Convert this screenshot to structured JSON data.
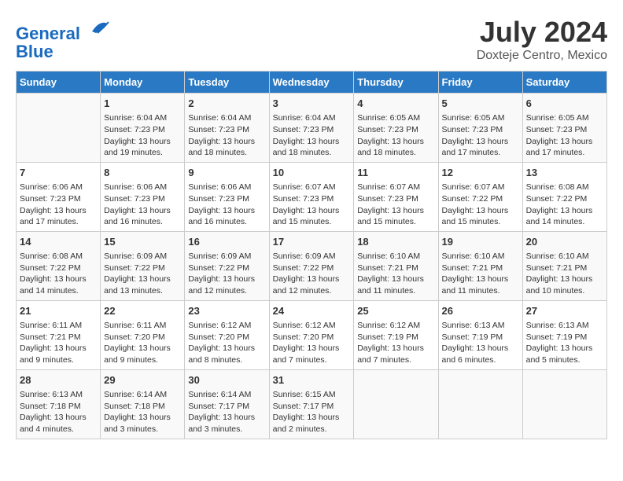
{
  "header": {
    "logo_line1": "General",
    "logo_line2": "Blue",
    "month": "July 2024",
    "location": "Doxteje Centro, Mexico"
  },
  "days_of_week": [
    "Sunday",
    "Monday",
    "Tuesday",
    "Wednesday",
    "Thursday",
    "Friday",
    "Saturday"
  ],
  "weeks": [
    [
      {
        "day": "",
        "sunrise": "",
        "sunset": "",
        "daylight": ""
      },
      {
        "day": "1",
        "sunrise": "Sunrise: 6:04 AM",
        "sunset": "Sunset: 7:23 PM",
        "daylight": "Daylight: 13 hours and 19 minutes."
      },
      {
        "day": "2",
        "sunrise": "Sunrise: 6:04 AM",
        "sunset": "Sunset: 7:23 PM",
        "daylight": "Daylight: 13 hours and 18 minutes."
      },
      {
        "day": "3",
        "sunrise": "Sunrise: 6:04 AM",
        "sunset": "Sunset: 7:23 PM",
        "daylight": "Daylight: 13 hours and 18 minutes."
      },
      {
        "day": "4",
        "sunrise": "Sunrise: 6:05 AM",
        "sunset": "Sunset: 7:23 PM",
        "daylight": "Daylight: 13 hours and 18 minutes."
      },
      {
        "day": "5",
        "sunrise": "Sunrise: 6:05 AM",
        "sunset": "Sunset: 7:23 PM",
        "daylight": "Daylight: 13 hours and 17 minutes."
      },
      {
        "day": "6",
        "sunrise": "Sunrise: 6:05 AM",
        "sunset": "Sunset: 7:23 PM",
        "daylight": "Daylight: 13 hours and 17 minutes."
      }
    ],
    [
      {
        "day": "7",
        "sunrise": "Sunrise: 6:06 AM",
        "sunset": "Sunset: 7:23 PM",
        "daylight": "Daylight: 13 hours and 17 minutes."
      },
      {
        "day": "8",
        "sunrise": "Sunrise: 6:06 AM",
        "sunset": "Sunset: 7:23 PM",
        "daylight": "Daylight: 13 hours and 16 minutes."
      },
      {
        "day": "9",
        "sunrise": "Sunrise: 6:06 AM",
        "sunset": "Sunset: 7:23 PM",
        "daylight": "Daylight: 13 hours and 16 minutes."
      },
      {
        "day": "10",
        "sunrise": "Sunrise: 6:07 AM",
        "sunset": "Sunset: 7:23 PM",
        "daylight": "Daylight: 13 hours and 15 minutes."
      },
      {
        "day": "11",
        "sunrise": "Sunrise: 6:07 AM",
        "sunset": "Sunset: 7:23 PM",
        "daylight": "Daylight: 13 hours and 15 minutes."
      },
      {
        "day": "12",
        "sunrise": "Sunrise: 6:07 AM",
        "sunset": "Sunset: 7:22 PM",
        "daylight": "Daylight: 13 hours and 15 minutes."
      },
      {
        "day": "13",
        "sunrise": "Sunrise: 6:08 AM",
        "sunset": "Sunset: 7:22 PM",
        "daylight": "Daylight: 13 hours and 14 minutes."
      }
    ],
    [
      {
        "day": "14",
        "sunrise": "Sunrise: 6:08 AM",
        "sunset": "Sunset: 7:22 PM",
        "daylight": "Daylight: 13 hours and 14 minutes."
      },
      {
        "day": "15",
        "sunrise": "Sunrise: 6:09 AM",
        "sunset": "Sunset: 7:22 PM",
        "daylight": "Daylight: 13 hours and 13 minutes."
      },
      {
        "day": "16",
        "sunrise": "Sunrise: 6:09 AM",
        "sunset": "Sunset: 7:22 PM",
        "daylight": "Daylight: 13 hours and 12 minutes."
      },
      {
        "day": "17",
        "sunrise": "Sunrise: 6:09 AM",
        "sunset": "Sunset: 7:22 PM",
        "daylight": "Daylight: 13 hours and 12 minutes."
      },
      {
        "day": "18",
        "sunrise": "Sunrise: 6:10 AM",
        "sunset": "Sunset: 7:21 PM",
        "daylight": "Daylight: 13 hours and 11 minutes."
      },
      {
        "day": "19",
        "sunrise": "Sunrise: 6:10 AM",
        "sunset": "Sunset: 7:21 PM",
        "daylight": "Daylight: 13 hours and 11 minutes."
      },
      {
        "day": "20",
        "sunrise": "Sunrise: 6:10 AM",
        "sunset": "Sunset: 7:21 PM",
        "daylight": "Daylight: 13 hours and 10 minutes."
      }
    ],
    [
      {
        "day": "21",
        "sunrise": "Sunrise: 6:11 AM",
        "sunset": "Sunset: 7:21 PM",
        "daylight": "Daylight: 13 hours and 9 minutes."
      },
      {
        "day": "22",
        "sunrise": "Sunrise: 6:11 AM",
        "sunset": "Sunset: 7:20 PM",
        "daylight": "Daylight: 13 hours and 9 minutes."
      },
      {
        "day": "23",
        "sunrise": "Sunrise: 6:12 AM",
        "sunset": "Sunset: 7:20 PM",
        "daylight": "Daylight: 13 hours and 8 minutes."
      },
      {
        "day": "24",
        "sunrise": "Sunrise: 6:12 AM",
        "sunset": "Sunset: 7:20 PM",
        "daylight": "Daylight: 13 hours and 7 minutes."
      },
      {
        "day": "25",
        "sunrise": "Sunrise: 6:12 AM",
        "sunset": "Sunset: 7:19 PM",
        "daylight": "Daylight: 13 hours and 7 minutes."
      },
      {
        "day": "26",
        "sunrise": "Sunrise: 6:13 AM",
        "sunset": "Sunset: 7:19 PM",
        "daylight": "Daylight: 13 hours and 6 minutes."
      },
      {
        "day": "27",
        "sunrise": "Sunrise: 6:13 AM",
        "sunset": "Sunset: 7:19 PM",
        "daylight": "Daylight: 13 hours and 5 minutes."
      }
    ],
    [
      {
        "day": "28",
        "sunrise": "Sunrise: 6:13 AM",
        "sunset": "Sunset: 7:18 PM",
        "daylight": "Daylight: 13 hours and 4 minutes."
      },
      {
        "day": "29",
        "sunrise": "Sunrise: 6:14 AM",
        "sunset": "Sunset: 7:18 PM",
        "daylight": "Daylight: 13 hours and 3 minutes."
      },
      {
        "day": "30",
        "sunrise": "Sunrise: 6:14 AM",
        "sunset": "Sunset: 7:17 PM",
        "daylight": "Daylight: 13 hours and 3 minutes."
      },
      {
        "day": "31",
        "sunrise": "Sunrise: 6:15 AM",
        "sunset": "Sunset: 7:17 PM",
        "daylight": "Daylight: 13 hours and 2 minutes."
      },
      {
        "day": "",
        "sunrise": "",
        "sunset": "",
        "daylight": ""
      },
      {
        "day": "",
        "sunrise": "",
        "sunset": "",
        "daylight": ""
      },
      {
        "day": "",
        "sunrise": "",
        "sunset": "",
        "daylight": ""
      }
    ]
  ]
}
